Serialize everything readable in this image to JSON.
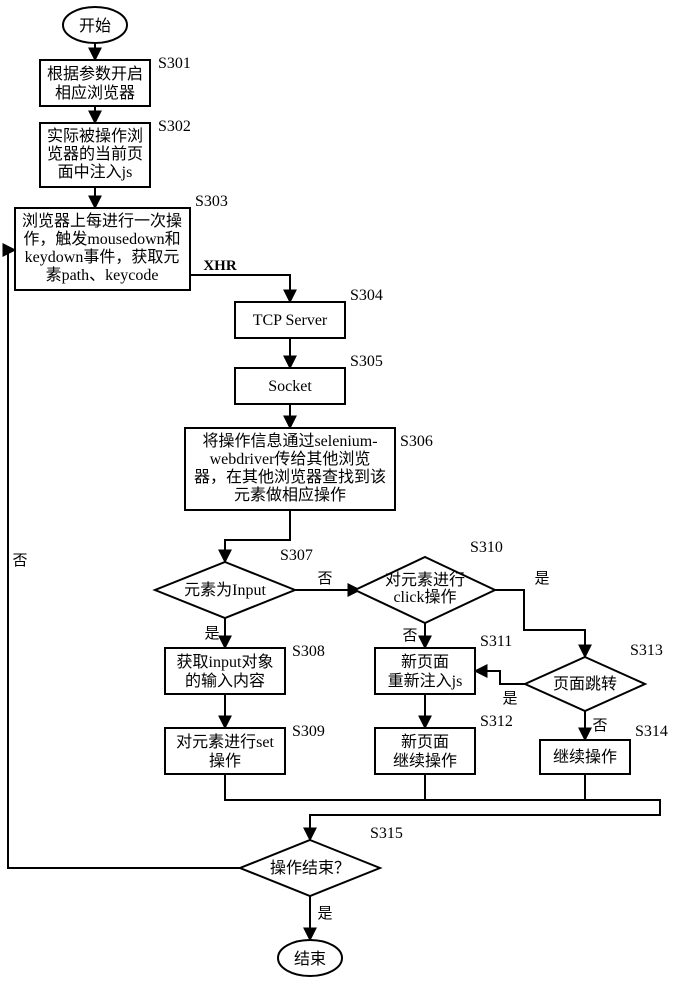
{
  "chart_data": {
    "type": "flowchart",
    "nodes": {
      "start": {
        "type": "terminator",
        "text": "开始"
      },
      "s301": {
        "type": "process",
        "text": [
          "根据参数开启",
          "相应浏览器"
        ],
        "label": "S301"
      },
      "s302": {
        "type": "process",
        "text": [
          "实际被操作浏",
          "览器的当前页",
          "面中注入js"
        ],
        "label": "S302"
      },
      "s303": {
        "type": "process",
        "text": [
          "浏览器上每进行一次操",
          "作，触发mousedown和",
          "keydown事件，获取元",
          "素path、keycode"
        ],
        "label": "S303"
      },
      "s304": {
        "type": "process",
        "text": [
          "TCP Server"
        ],
        "label": "S304",
        "edgeInLabel": "XHR"
      },
      "s305": {
        "type": "process",
        "text": [
          "Socket"
        ],
        "label": "S305"
      },
      "s306": {
        "type": "process",
        "text": [
          "将操作信息通过selenium-",
          "webdriver传给其他浏览",
          "器，在其他浏览器查找到该",
          "元素做相应操作"
        ],
        "label": "S306"
      },
      "s307": {
        "type": "decision",
        "text": "元素为Input",
        "label": "S307"
      },
      "s308": {
        "type": "process",
        "text": [
          "获取input对象",
          "的输入内容"
        ],
        "label": "S308"
      },
      "s309": {
        "type": "process",
        "text": [
          "对元素进行set",
          "操作"
        ],
        "label": "S309"
      },
      "s310": {
        "type": "decision",
        "text": [
          "对元素进行",
          "click操作"
        ],
        "label": "S310"
      },
      "s311": {
        "type": "process",
        "text": [
          "新页面",
          "重新注入js"
        ],
        "label": "S311"
      },
      "s312": {
        "type": "process",
        "text": [
          "新页面",
          "继续操作"
        ],
        "label": "S312"
      },
      "s313": {
        "type": "decision",
        "text": "页面跳转",
        "label": "S313"
      },
      "s314": {
        "type": "process",
        "text": [
          "继续操作"
        ],
        "label": "S314"
      },
      "s315": {
        "type": "decision",
        "text": "操作结束？",
        "label": "S315"
      },
      "end": {
        "type": "terminator",
        "text": "结束"
      }
    },
    "edges": [
      {
        "from": "start",
        "to": "s301"
      },
      {
        "from": "s301",
        "to": "s302"
      },
      {
        "from": "s302",
        "to": "s303"
      },
      {
        "from": "s303",
        "to": "s304",
        "label": "XHR"
      },
      {
        "from": "s304",
        "to": "s305"
      },
      {
        "from": "s305",
        "to": "s306"
      },
      {
        "from": "s306",
        "to": "s307"
      },
      {
        "from": "s307",
        "to": "s308",
        "label": "是"
      },
      {
        "from": "s307",
        "to": "s310",
        "label": "否"
      },
      {
        "from": "s308",
        "to": "s309"
      },
      {
        "from": "s310",
        "to": "s311",
        "label": "否"
      },
      {
        "from": "s310",
        "to": "s313",
        "label": "是"
      },
      {
        "from": "s311",
        "to": "s312"
      },
      {
        "from": "s313",
        "to": "s311",
        "label": "是"
      },
      {
        "from": "s313",
        "to": "s314",
        "label": "否"
      },
      {
        "from": "s309",
        "to": "s315"
      },
      {
        "from": "s312",
        "to": "s315"
      },
      {
        "from": "s314",
        "to": "s315"
      },
      {
        "from": "s315",
        "to": "end",
        "label": "是"
      },
      {
        "from": "s315",
        "to": "s303",
        "label": "否"
      }
    ],
    "edge_labels": {
      "yes": "是",
      "no": "否"
    }
  }
}
